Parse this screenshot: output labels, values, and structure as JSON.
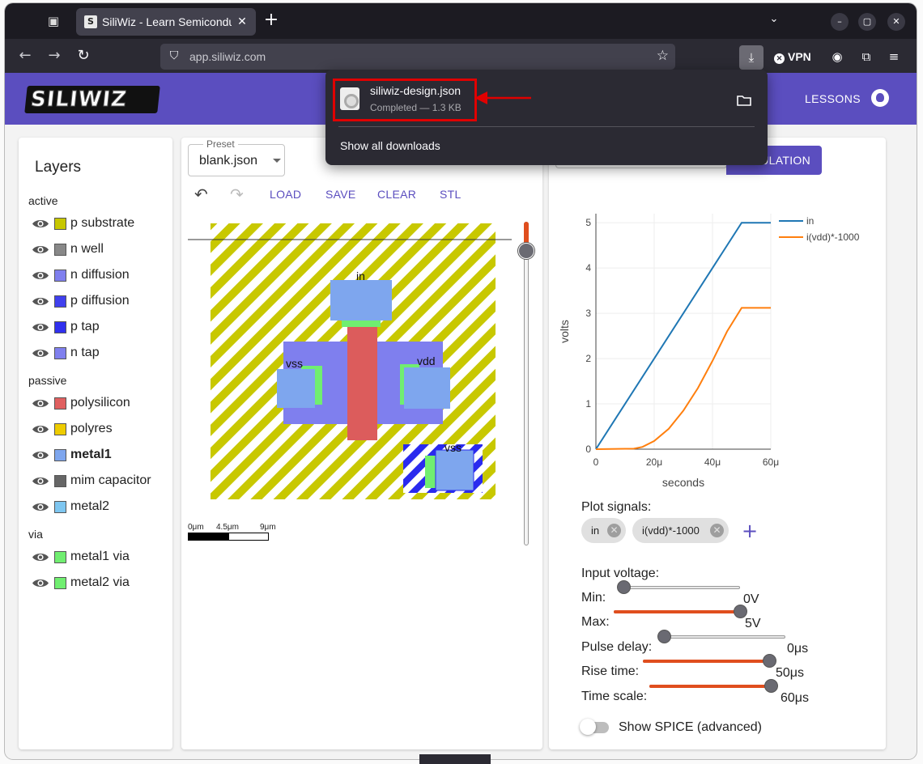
{
  "browser": {
    "tab_title": "SiliWiz - Learn Semiconductor",
    "favicon_letter": "S",
    "url": "app.siliwiz.com",
    "vpn_label": "VPN"
  },
  "downloads": {
    "filename": "siliwiz-design.json",
    "status": "Completed — 1.3 KB",
    "show_all": "Show all downloads",
    "highlight_color": "#e00000"
  },
  "site": {
    "logo": "SILIWIZ",
    "lessons": "LESSONS",
    "brand_color": "#5b4ebf"
  },
  "layers_panel": {
    "title": "Layers",
    "groups": [
      {
        "label": "active"
      },
      {
        "label": "passive"
      },
      {
        "label": "via"
      }
    ],
    "items": [
      {
        "name": "p substrate",
        "color": "#c7c700",
        "group": "active"
      },
      {
        "name": "n well",
        "color": "#888888",
        "group": "active"
      },
      {
        "name": "n diffusion",
        "color": "#7f7fee",
        "group": "active"
      },
      {
        "name": "p diffusion",
        "color": "#4040ee",
        "group": "active"
      },
      {
        "name": "p tap",
        "color": "#3030ee",
        "group": "active"
      },
      {
        "name": "n tap",
        "color": "#8080ee",
        "group": "active"
      },
      {
        "name": "polysilicon",
        "color": "#e06060",
        "group": "passive"
      },
      {
        "name": "polyres",
        "color": "#eecc00",
        "group": "passive"
      },
      {
        "name": "metal1",
        "color": "#7ea6ee",
        "group": "passive",
        "bold": true
      },
      {
        "name": "mim capacitor",
        "color": "#666666",
        "group": "passive"
      },
      {
        "name": "metal2",
        "color": "#7ec6f0",
        "group": "passive"
      },
      {
        "name": "metal1 via",
        "color": "#70ee70",
        "group": "via"
      },
      {
        "name": "metal2 via",
        "color": "#70ee70",
        "group": "via"
      }
    ]
  },
  "editor": {
    "preset_label": "Preset",
    "preset_value": "blank.json",
    "buttons": {
      "load": "LOAD",
      "save": "SAVE",
      "clear": "CLEAR",
      "stl": "STL"
    },
    "labels": {
      "in": "in",
      "vss1": "vss",
      "vdd": "vdd",
      "vss2": "vss"
    },
    "scale": {
      "t0": "0μm",
      "t1": "4.5μm",
      "t2": "9μm"
    }
  },
  "sim_panel": {
    "button_label": "ULATION",
    "plot_signals_label": "Plot signals:",
    "signals": [
      "in",
      "i(vdd)*-1000"
    ],
    "add": "+",
    "input_voltage_label": "Input voltage:",
    "controls": [
      {
        "label": "Min:",
        "value": "0V",
        "fraction": 0.0
      },
      {
        "label": "Max:",
        "value": "5V",
        "fraction": 1.0
      },
      {
        "label": "Pulse delay:",
        "value": "0μs",
        "fraction": 0.0
      },
      {
        "label": "Rise time:",
        "value": "50μs",
        "fraction": 1.0
      },
      {
        "label": "Time scale:",
        "value": "60μs",
        "fraction": 0.95
      }
    ],
    "spice_toggle": "Show SPICE (advanced)"
  },
  "chart_data": {
    "type": "line",
    "xlabel": "seconds",
    "ylabel": "volts",
    "xlim": [
      0,
      60
    ],
    "ylim": [
      0,
      5.2
    ],
    "x_ticks": [
      "0",
      "20μ",
      "40μ",
      "60μ"
    ],
    "y_ticks": [
      "0",
      "1",
      "2",
      "3",
      "4",
      "5"
    ],
    "legend_position": "top-right",
    "series": [
      {
        "name": "in",
        "color": "#1f77b4",
        "x": [
          0,
          50,
          60
        ],
        "y": [
          0,
          5,
          5
        ]
      },
      {
        "name": "i(vdd)*-1000",
        "color": "#ff7f0e",
        "x": [
          0,
          13,
          16,
          20,
          25,
          30,
          35,
          40,
          45,
          50,
          60
        ],
        "y": [
          0,
          0.01,
          0.05,
          0.18,
          0.45,
          0.85,
          1.35,
          1.95,
          2.6,
          3.12,
          3.12
        ]
      }
    ]
  }
}
